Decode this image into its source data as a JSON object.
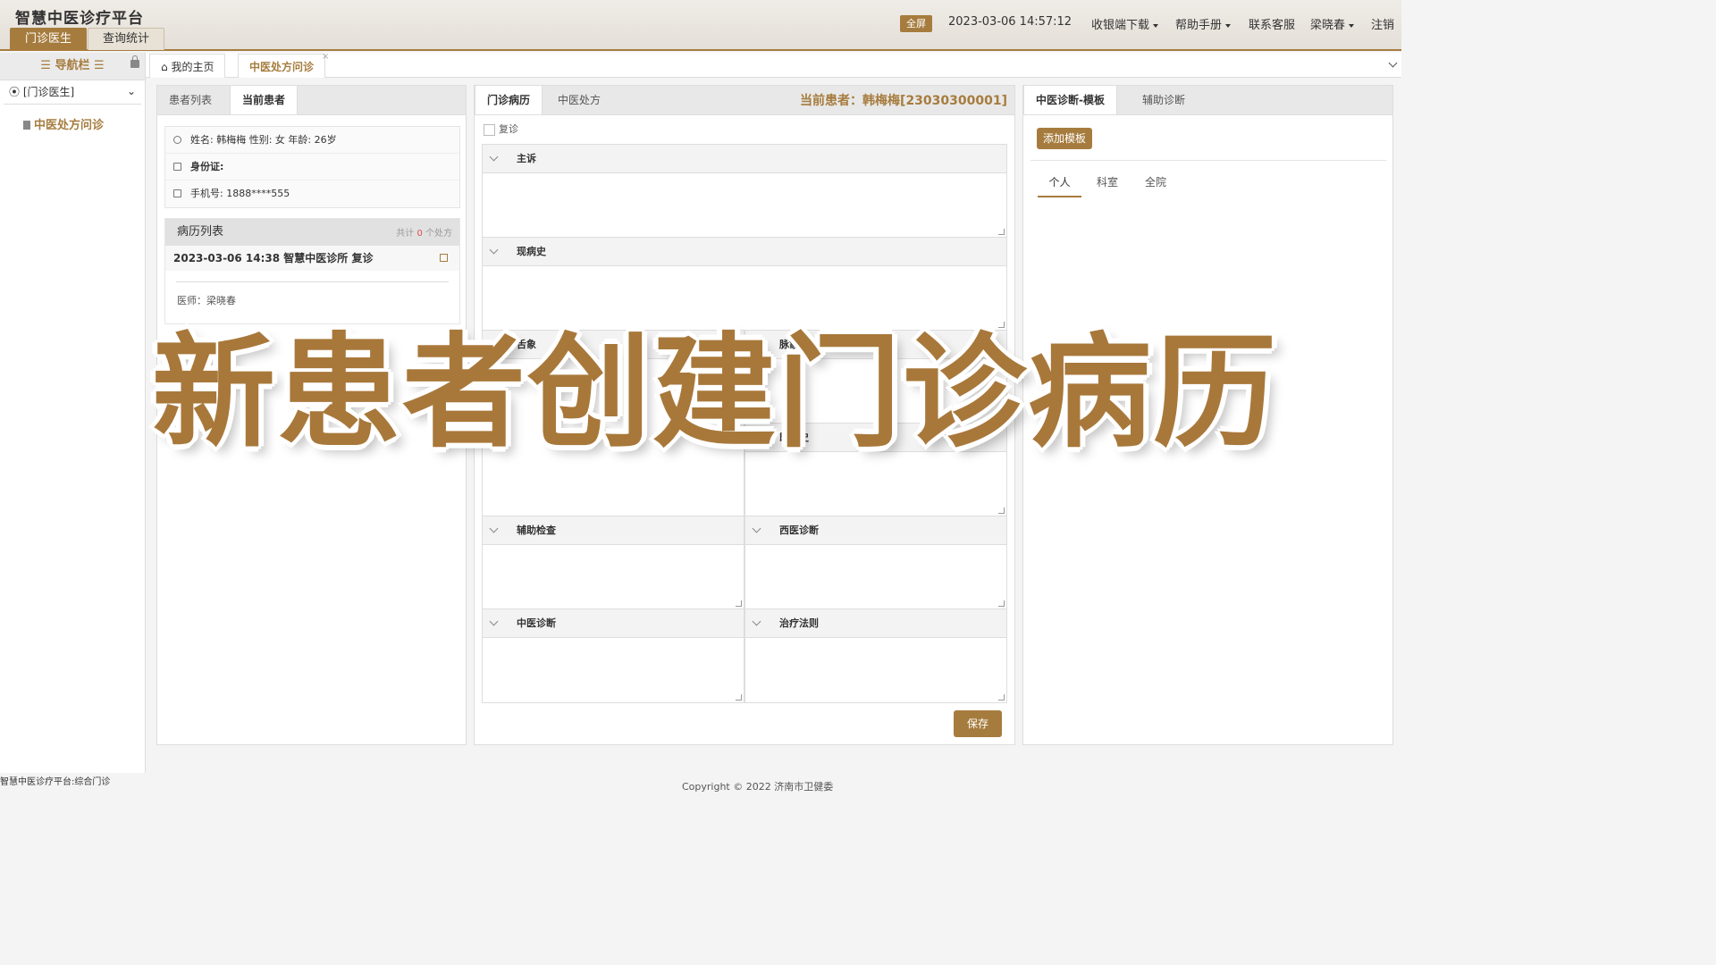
{
  "header": {
    "app_title": "智慧中医诊疗平台",
    "tabs": [
      "门诊医生",
      "查询统计"
    ],
    "fullscreen": "全屏",
    "datetime": "2023-03-06 14:57:12",
    "menu": [
      "收银端下载",
      "帮助手册",
      "联系客服",
      "梁晓春"
    ],
    "logout": "注销"
  },
  "sidebar": {
    "title": "导航栏",
    "group": "[门诊医生]",
    "item": "中医处方问诊"
  },
  "page_tabs": [
    "我的主页",
    "中医处方问诊"
  ],
  "left_panel": {
    "tabs": [
      "患者列表",
      "当前患者"
    ],
    "name_line": "姓名: 韩梅梅 性别: 女 年龄: 26岁",
    "id_label": "身份证:",
    "phone_line": "手机号: 1888****555",
    "records_title": "病历列表",
    "total_prefix": "共计",
    "total_count": "0",
    "total_suffix": "个处方",
    "record_item": "2023-03-06 14:38 智慧中医诊所 复诊",
    "doctor": "医师：梁晓春"
  },
  "middle_panel": {
    "tabs": [
      "门诊病历",
      "中医处方"
    ],
    "current_patient": "当前患者：韩梅梅[23030300001]",
    "revisit_label": "复诊",
    "fields": [
      "主诉",
      "现病史",
      "舌象",
      "脉象",
      "既往史",
      "辅助检查",
      "西医诊断",
      "中医诊断",
      "治疗法则"
    ],
    "save": "保存"
  },
  "right_panel": {
    "tabs": [
      "中医诊断-模板",
      "辅助诊断"
    ],
    "add_template": "添加模板",
    "subtabs": [
      "个人",
      "科室",
      "全院"
    ]
  },
  "footer": {
    "status": "智慧中医诊疗平台:综合门诊",
    "copyright": "Copyright © 2022  济南市卫健委"
  },
  "overlay_title": "新患者创建门诊病历",
  "colors": {
    "accent": "#a67c3e",
    "count_red": "#d9534f"
  }
}
